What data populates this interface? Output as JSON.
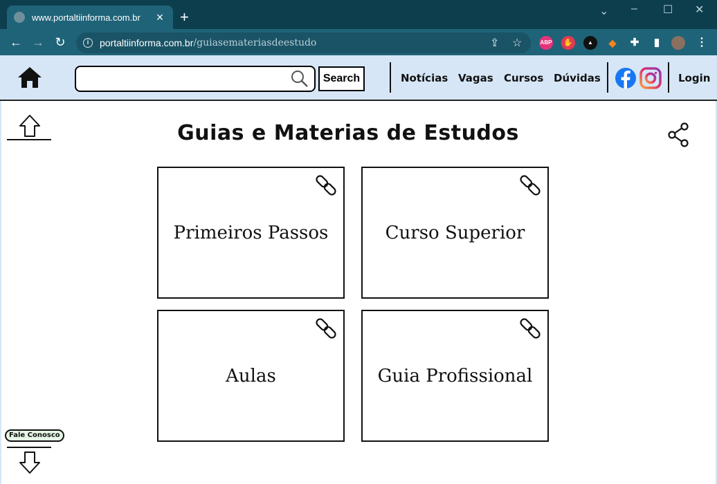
{
  "browser": {
    "tab_title": "www.portaltiinforma.com.br",
    "new_tab": "+",
    "url_host": "portaltiinforma.com.br",
    "url_path": "/guiasemateriasdeestudo",
    "ext_abp": "ABP"
  },
  "header": {
    "search_placeholder": "",
    "search_button": "Search",
    "nav": [
      "Notícias",
      "Vagas",
      "Cursos",
      "Dúvidas"
    ],
    "login": "Login"
  },
  "page": {
    "title": "Guias e Materias de Estudos",
    "cards": [
      {
        "label": "Primeiros Passos"
      },
      {
        "label": "Curso Superior"
      },
      {
        "label": "Aulas"
      },
      {
        "label": "Guia Profissional"
      }
    ],
    "contact_button": "Fale Conosco"
  },
  "icons": {
    "home": "home-icon",
    "search": "search-icon",
    "share": "share-icon",
    "link": "link-icon",
    "up": "up-arrow-icon",
    "down": "down-arrow-icon",
    "facebook": "facebook-icon",
    "instagram": "instagram-icon"
  },
  "colors": {
    "chrome_dark": "#0c3e4e",
    "chrome_toolbar": "#1f6378",
    "header_bg": "#d6e6f6",
    "facebook": "#1877f2"
  }
}
